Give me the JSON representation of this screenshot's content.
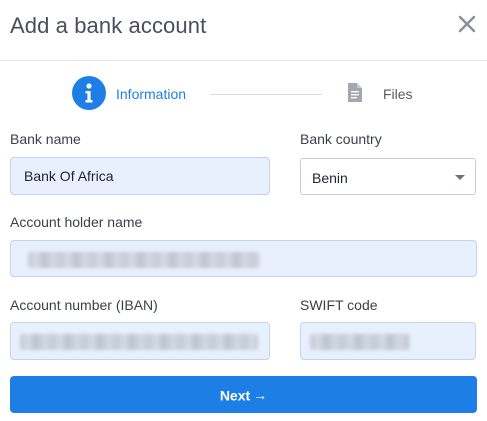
{
  "dialog": {
    "title": "Add a bank account"
  },
  "stepper": {
    "steps": [
      {
        "label": "Information",
        "icon": "info-icon",
        "active": true
      },
      {
        "label": "Files",
        "icon": "document-icon",
        "active": false
      }
    ]
  },
  "form": {
    "bank_name": {
      "label": "Bank name",
      "value": "Bank Of Africa"
    },
    "bank_country": {
      "label": "Bank country",
      "value": "Benin"
    },
    "account_holder": {
      "label": "Account holder name",
      "value": ""
    },
    "account_number": {
      "label": "Account number (IBAN)",
      "value": ""
    },
    "swift_code": {
      "label": "SWIFT code",
      "value": ""
    }
  },
  "actions": {
    "next_label": "Next",
    "next_arrow": "→"
  },
  "colors": {
    "accent": "#1d7fe5",
    "field_bg": "#e8effd"
  }
}
